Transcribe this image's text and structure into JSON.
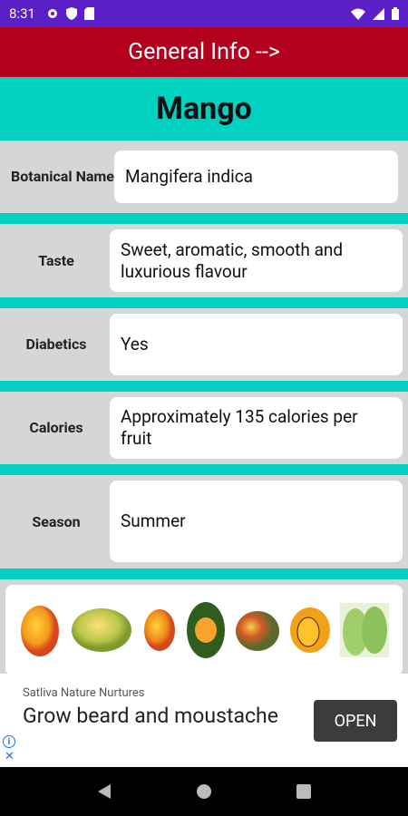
{
  "status_bar": {
    "time": "8:31"
  },
  "header": {
    "title": "General Info -->"
  },
  "fruit": {
    "name": "Mango"
  },
  "rows": [
    {
      "label": "Botanical Name",
      "value": "Mangifera indica"
    },
    {
      "label": "Taste",
      "value": "Sweet, aromatic, smooth and luxurious flavour"
    },
    {
      "label": "Diabetics",
      "value": "Yes"
    },
    {
      "label": "Calories",
      "value": "Approximately 135 calories per fruit"
    },
    {
      "label": "Season",
      "value": "Summer"
    }
  ],
  "ad": {
    "sponsor": "Satliva Nature Nurtures",
    "headline": "Grow beard and moustache",
    "cta": "OPEN"
  },
  "colors": {
    "accent": "#00d1c1",
    "header": "#b3001f",
    "status": "#5a1fc7"
  }
}
